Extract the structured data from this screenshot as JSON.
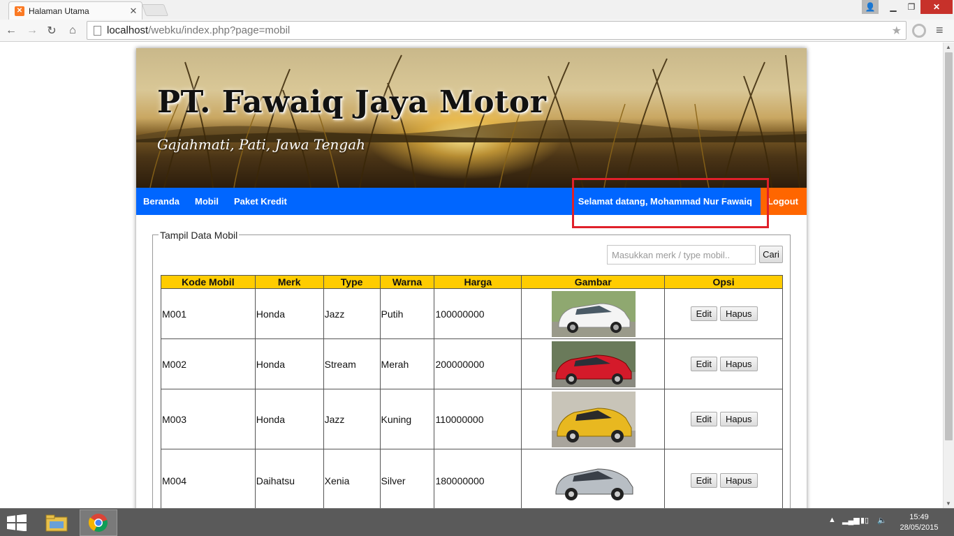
{
  "browser": {
    "tab_title": "Halaman Utama",
    "tab_favicon": "xampp-icon",
    "url_host": "localhost",
    "url_path": "/webku/index.php?page=mobil"
  },
  "site": {
    "title": "PT. Fawaiq Jaya Motor",
    "subtitle": "Gajahmati, Pati, Jawa Tengah"
  },
  "nav": {
    "items": [
      "Beranda",
      "Mobil",
      "Paket Kredit"
    ],
    "welcome": "Selamat datang, Mohammad Nur Fawaiq",
    "logout": "Logout"
  },
  "panel": {
    "legend": "Tampil Data Mobil",
    "search_placeholder": "Masukkan merk / type mobil..",
    "search_button": "Cari"
  },
  "table": {
    "headers": [
      "Kode Mobil",
      "Merk",
      "Type",
      "Warna",
      "Harga",
      "Gambar",
      "Opsi"
    ],
    "rows": [
      {
        "kode": "M001",
        "merk": "Honda",
        "type": "Jazz",
        "warna": "Putih",
        "harga": "100000000",
        "image": "car-white-icon"
      },
      {
        "kode": "M002",
        "merk": "Honda",
        "type": "Stream",
        "warna": "Merah",
        "harga": "200000000",
        "image": "car-red-icon"
      },
      {
        "kode": "M003",
        "merk": "Honda",
        "type": "Jazz",
        "warna": "Kuning",
        "harga": "110000000",
        "image": "car-yellow-icon"
      },
      {
        "kode": "M004",
        "merk": "Daihatsu",
        "type": "Xenia",
        "warna": "Silver",
        "harga": "180000000",
        "image": "car-silver-icon"
      }
    ],
    "edit_label": "Edit",
    "delete_label": "Hapus"
  },
  "colors": {
    "nav_bg": "#0066ff",
    "logout_bg": "#ff6600",
    "table_header_bg": "#ffcc00",
    "highlight": "#e0202a"
  },
  "taskbar": {
    "time": "15:49",
    "date": "28/05/2015"
  }
}
